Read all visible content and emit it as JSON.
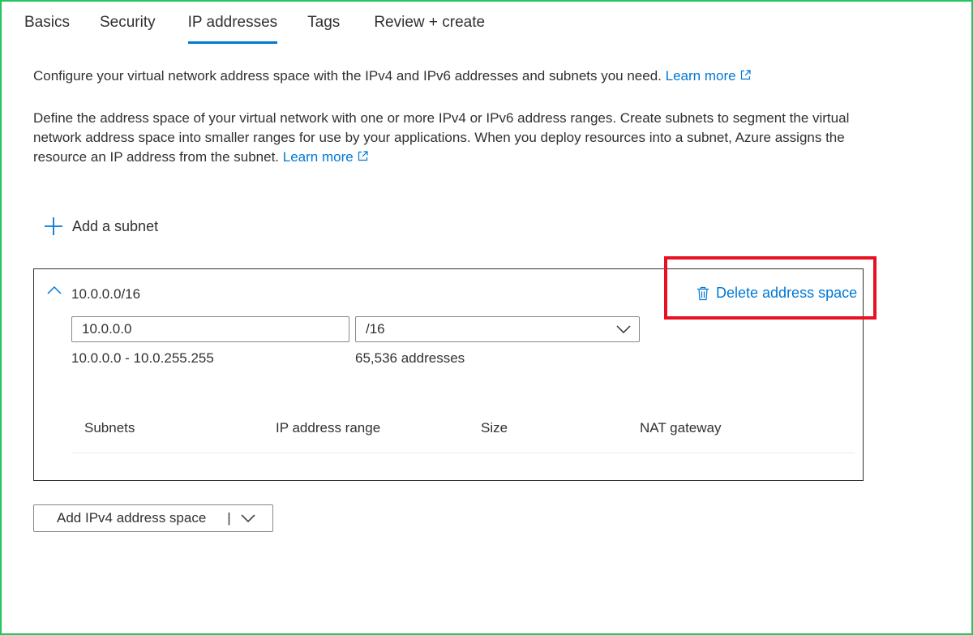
{
  "tabs": [
    {
      "label": "Basics",
      "active": false
    },
    {
      "label": "Security",
      "active": false
    },
    {
      "label": "IP addresses",
      "active": true
    },
    {
      "label": "Tags",
      "active": false
    },
    {
      "label": "Review + create",
      "active": false
    }
  ],
  "intro": {
    "text": "Configure your virtual network address space with the IPv4 and IPv6 addresses and subnets you need.",
    "link": "Learn more"
  },
  "description": {
    "text": "Define the address space of your virtual network with one or more IPv4 or IPv6 address ranges. Create subnets to segment the virtual network address space into smaller ranges for use by your applications. When you deploy resources into a subnet, Azure assigns the resource an IP address from the subnet.",
    "link": "Learn more"
  },
  "add_subnet": {
    "label": "Add a subnet",
    "icon": "plus-icon"
  },
  "address_space": {
    "title": "10.0.0.0/16",
    "delete_label": "Delete address space",
    "ip_value": "10.0.0.0",
    "cidr_value": "/16",
    "range": "10.0.0.0 - 10.0.255.255",
    "count": "65,536 addresses",
    "columns": [
      "Subnets",
      "IP address range",
      "Size",
      "NAT gateway"
    ]
  },
  "add_ipv4": {
    "label": "Add IPv4 address space",
    "separator": "|"
  },
  "colors": {
    "accent": "#0078d4",
    "highlight": "#e81123",
    "frame": "#22c55e"
  }
}
